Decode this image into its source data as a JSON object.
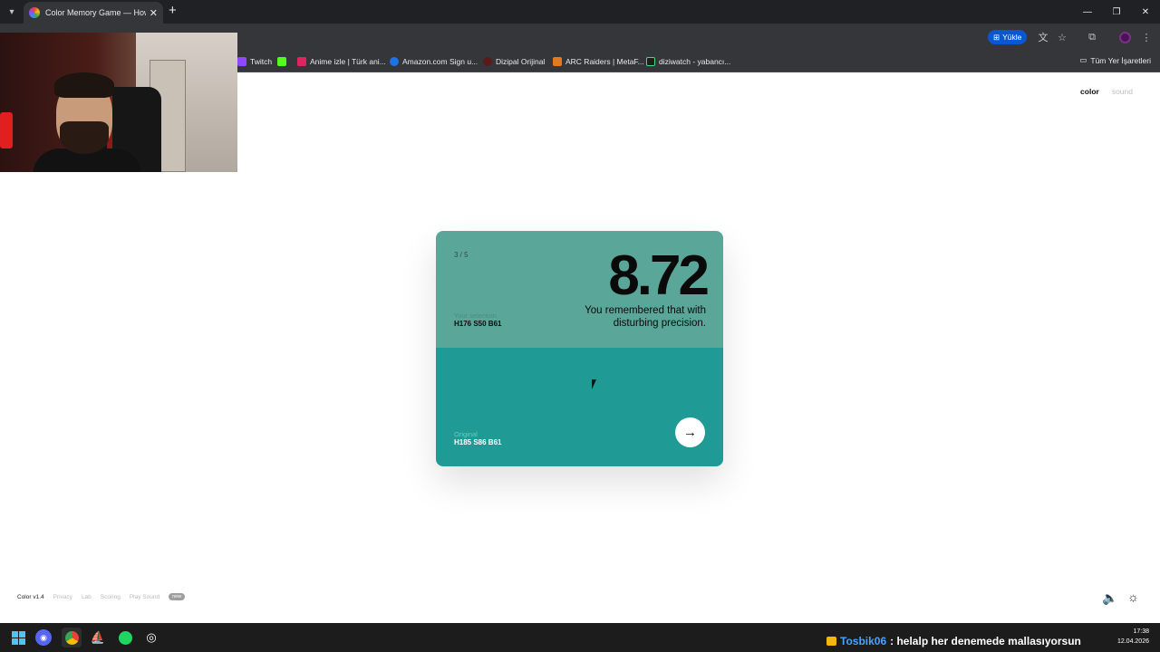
{
  "browser": {
    "tab_title": "Color Memory Game — How W",
    "install_label": "Yükle",
    "bookmarks": [
      {
        "label": "Twitch",
        "color": "#9146ff"
      },
      {
        "label": "",
        "color": "#53fc18"
      },
      {
        "label": "Anime izle | Türk ani...",
        "color": "#e0245e"
      },
      {
        "label": "Amazon.com Sign u...",
        "color": "#1a73e8"
      },
      {
        "label": "Dizipal Orijinal",
        "color": "#5a1a1a"
      },
      {
        "label": "ARC Raiders | MetaF...",
        "color": "#e07b20"
      },
      {
        "label": "diziwatch - yabancı...",
        "color": "#1f1f1f"
      }
    ],
    "all_bookmarks_label": "Tüm Yer İşaretleri"
  },
  "nav": {
    "color": "color",
    "sound": "sound"
  },
  "card": {
    "round": "3 / 5",
    "score": "8.72",
    "message": "You remembered that with disturbing precision.",
    "selection_label": "Your selection",
    "selection_value": "H176 S50 B61",
    "original_label": "Original",
    "original_value": "H185 S86 B61",
    "selection_color": "#5aa699",
    "original_color": "#1f9a95"
  },
  "footer": {
    "version": "Color v1.4",
    "links": [
      "Privacy",
      "Lab",
      "Scoring",
      "Play Sound"
    ],
    "badge": "new"
  },
  "taskbar": {
    "chat_user": "Tosbik06",
    "chat_message": ": helalp her denemede mallasıyorsun",
    "time": "17:38",
    "date": "12.04.2026"
  }
}
